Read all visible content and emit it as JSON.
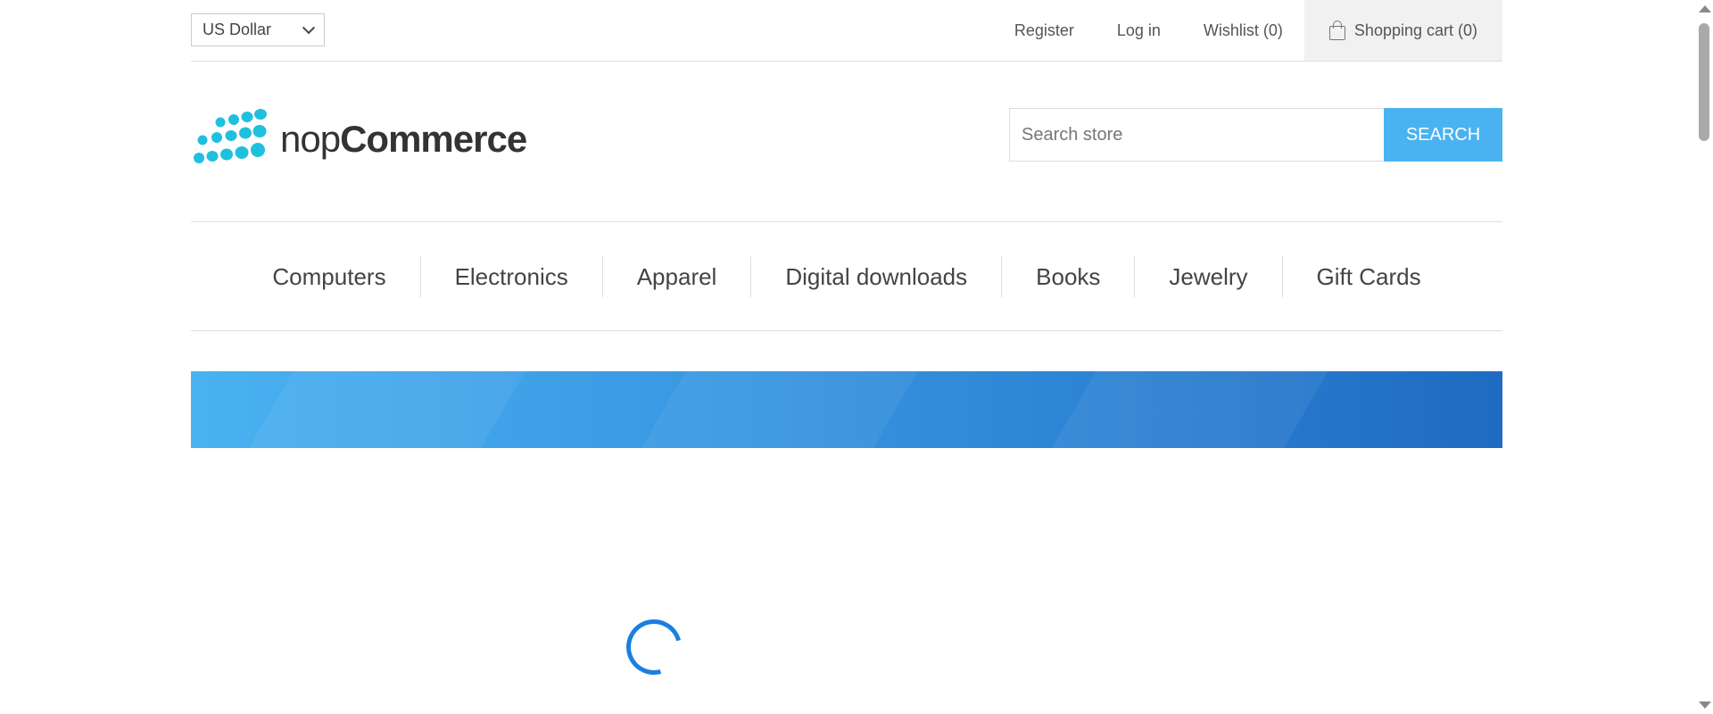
{
  "header": {
    "currency": {
      "selected": "US Dollar"
    },
    "links": {
      "register": "Register",
      "login": "Log in",
      "wishlist": "Wishlist (0)",
      "cart": "Shopping cart (0)"
    }
  },
  "logo": {
    "prefix": "nop",
    "name": "Commerce"
  },
  "search": {
    "placeholder": "Search store",
    "button_label": "SEARCH"
  },
  "menu": {
    "items": [
      {
        "label": "Computers"
      },
      {
        "label": "Electronics"
      },
      {
        "label": "Apparel"
      },
      {
        "label": "Digital downloads"
      },
      {
        "label": "Books"
      },
      {
        "label": "Jewelry"
      },
      {
        "label": "Gift Cards"
      }
    ]
  },
  "colors": {
    "accent": "#4ab2f1",
    "logo_dots": "#1fc0de",
    "spinner": "#1a7fe0"
  }
}
